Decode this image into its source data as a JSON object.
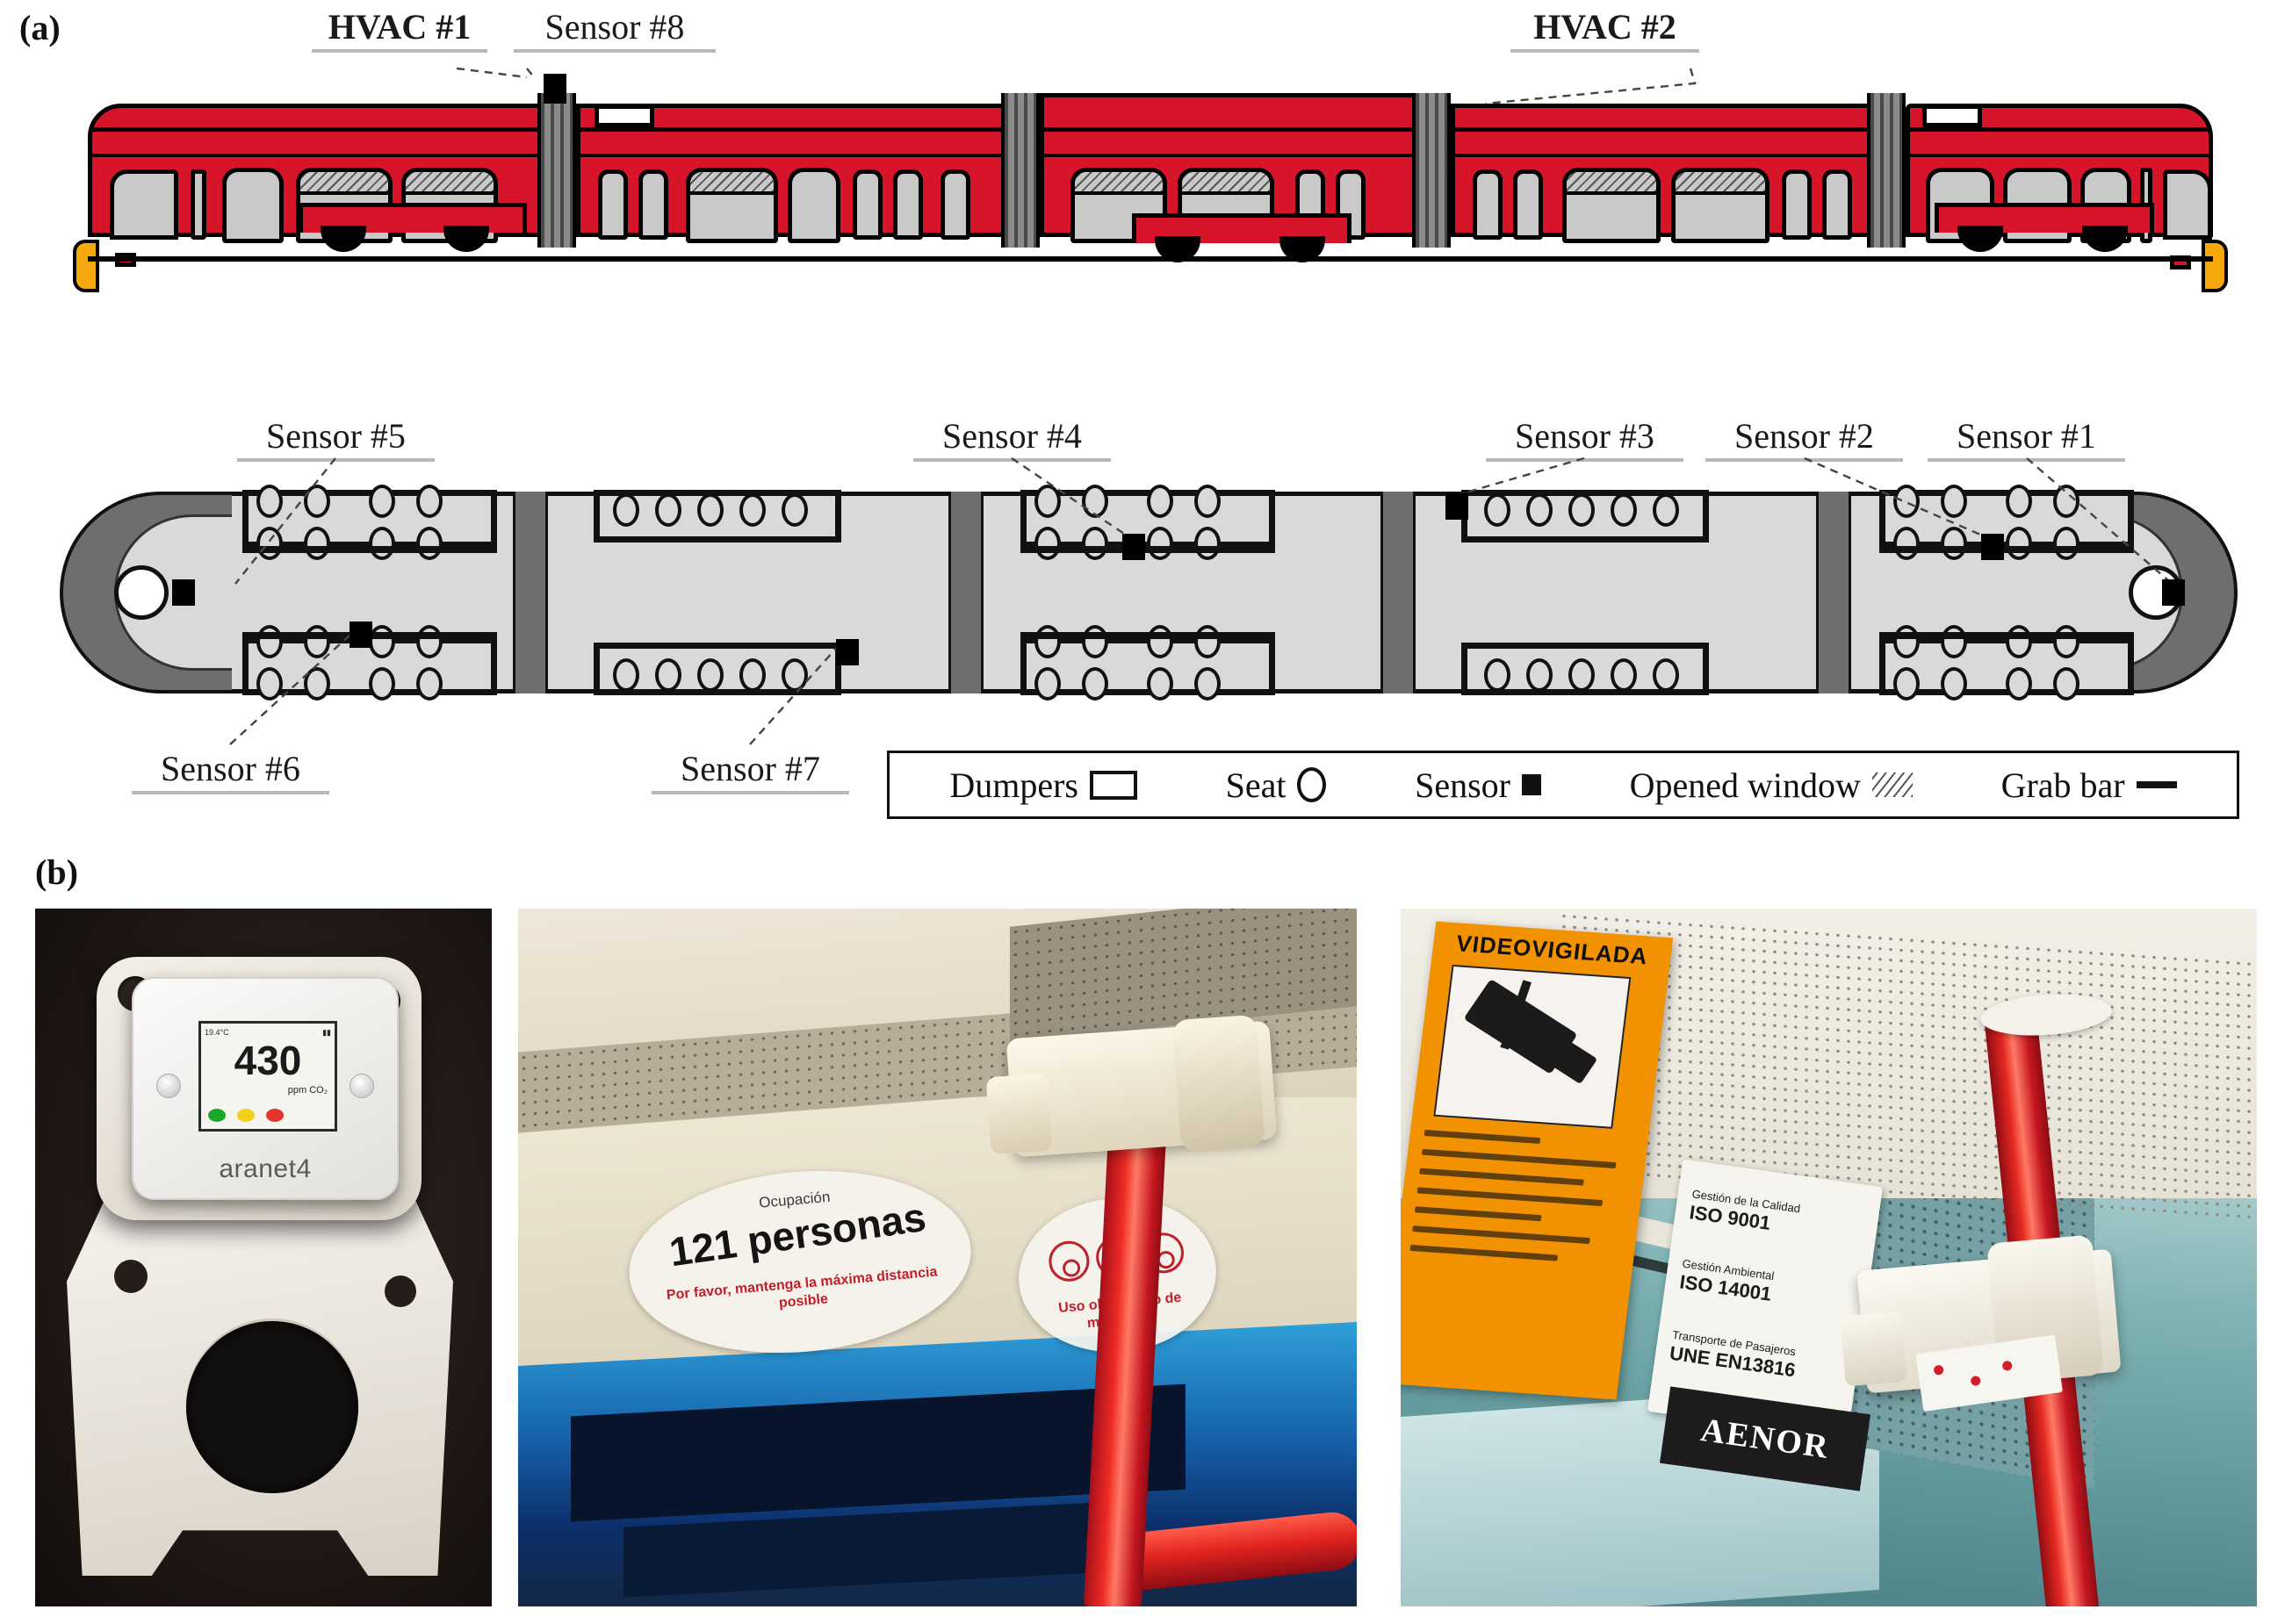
{
  "figure": {
    "panel_a_letter": "(a)",
    "panel_b_letter": "(b)"
  },
  "panel_a": {
    "side_view_callouts": [
      {
        "label": "HVAC #1",
        "bold": true
      },
      {
        "label": "Sensor #8",
        "bold": false
      },
      {
        "label": "HVAC #2",
        "bold": true
      }
    ],
    "plan_callouts_top": [
      {
        "label": "Sensor #5"
      },
      {
        "label": "Sensor #4"
      },
      {
        "label": "Sensor #3"
      },
      {
        "label": "Sensor #2"
      },
      {
        "label": "Sensor #1"
      }
    ],
    "plan_callouts_bottom": [
      {
        "label": "Sensor #6"
      },
      {
        "label": "Sensor #7"
      }
    ],
    "legend": {
      "items": [
        {
          "label": "Dumpers",
          "symbol": "rectangle-outline"
        },
        {
          "label": "Seat",
          "symbol": "circle-outline"
        },
        {
          "label": "Sensor",
          "symbol": "filled-square"
        },
        {
          "label": "Opened window",
          "symbol": "diagonal-hatch"
        },
        {
          "label": "Grab bar",
          "symbol": "thick-line"
        }
      ]
    },
    "colors": {
      "tram_body": "#d6152a",
      "window_glass": "#c9c9c9",
      "bellows_gray": "#6e6e6e",
      "headlamp_orange": "#f7a80d",
      "plan_interior": "#d9d9d9",
      "sensor_black": "#000000"
    },
    "plan": {
      "module_seat_counts": [
        {
          "module": 1,
          "top_row_seats": 8,
          "bottom_row_seats": 8
        },
        {
          "module": 2,
          "top_row_seats": 5,
          "bottom_row_seats": 5
        },
        {
          "module": 3,
          "top_row_seats": 8,
          "bottom_row_seats": 8
        },
        {
          "module": 4,
          "top_row_seats": 5,
          "bottom_row_seats": 5
        },
        {
          "module": 5,
          "top_row_seats": 8,
          "bottom_row_seats": 8
        }
      ],
      "sensor_count": 8,
      "hvac_count": 2
    }
  },
  "panel_b": {
    "photo_sensor_device": {
      "caption_alt": "Aranet4 CO2 sensor in 3D-printed mount",
      "display": {
        "temperature": "19.4°C",
        "co2_value": "430",
        "co2_unit": "ppm CO₂",
        "humidity_icon": "droplet-icon",
        "battery_icon": "battery-icon",
        "bluetooth_icon": "bluetooth-icon",
        "led_colors": [
          "#19a828",
          "#f2d01a",
          "#e5322b"
        ]
      },
      "brand": "aranet4"
    },
    "photo_pole_mount": {
      "caption_alt": "Sensor bracket clamped on tram grab pole",
      "stickers": [
        {
          "small": "Ocupación",
          "big": "121 personas",
          "note": "Por favor, mantenga la máxima distancia posible"
        },
        {
          "note": "Uso obligatorio de mascarilla"
        }
      ]
    },
    "photo_ceiling_mount": {
      "caption_alt": "Sensor bracket on ceiling pole next to signage",
      "signs": {
        "cctv_sign": "VIDEOVIGILADA",
        "plaque": [
          {
            "caption": "Gestión de la Calidad",
            "value": "ISO 9001"
          },
          {
            "caption": "Gestión Ambiental",
            "value": "ISO 14001"
          },
          {
            "caption": "Transporte de Pasajeros",
            "value": "UNE EN13816"
          }
        ],
        "certifier": "AENOR"
      }
    }
  }
}
